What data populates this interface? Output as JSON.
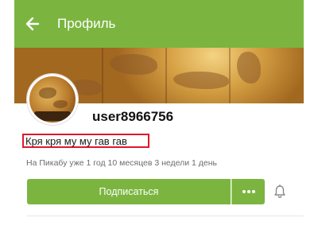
{
  "appbar": {
    "title": "Профиль",
    "back_icon": "arrow-left-icon",
    "color": "#7bb540"
  },
  "profile": {
    "username": "user8966756",
    "status": "Кря кря му му гав гав",
    "status_highlight_color": "#e1182c",
    "member_since": "На Пикабу уже 1 год 10 месяцев 3 недели 1 день"
  },
  "actions": {
    "subscribe_label": "Подписаться",
    "more_icon": "more-dots-icon",
    "bell_icon": "bell-icon",
    "accent": "#7bb540"
  }
}
